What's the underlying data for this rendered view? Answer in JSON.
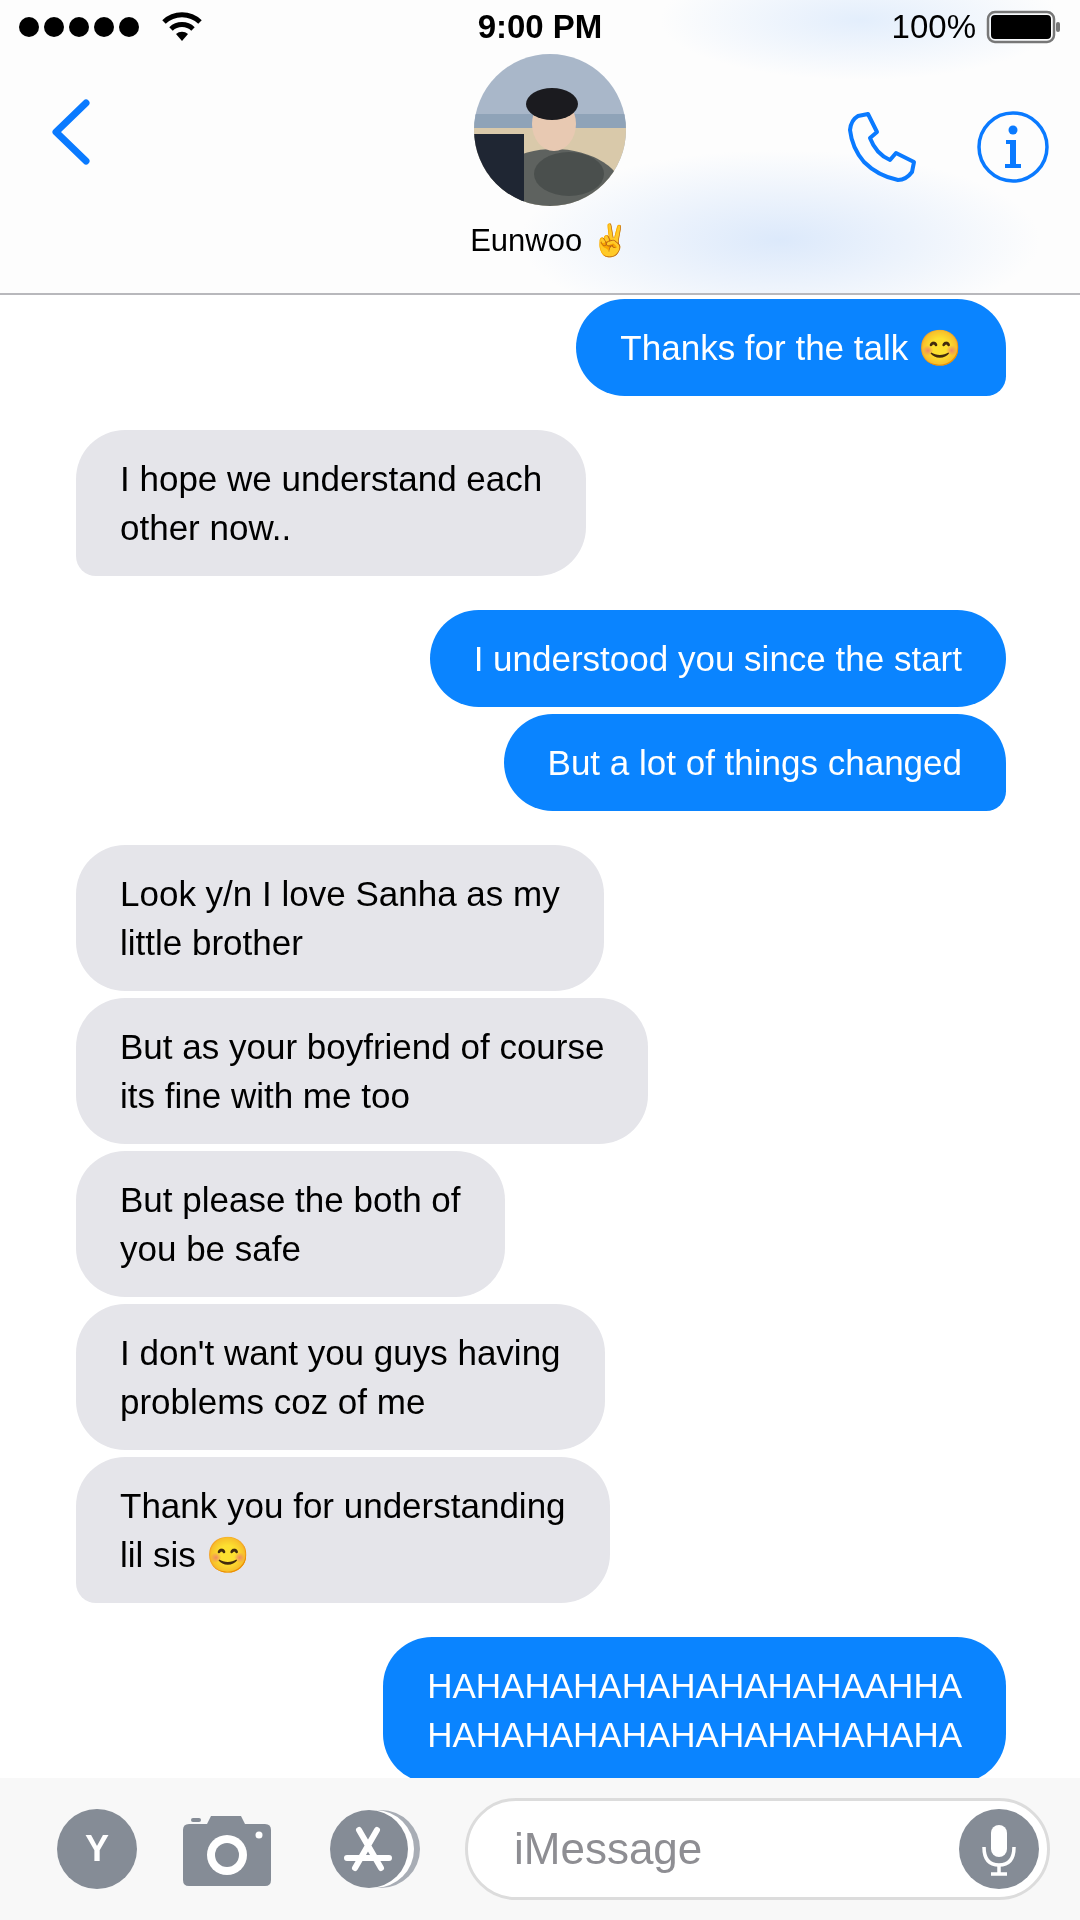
{
  "status_bar": {
    "time": "9:00 PM",
    "battery": "100%"
  },
  "header": {
    "contact_name": "Eunwoo ✌️"
  },
  "messages": [
    {
      "outgoing": true,
      "tail": true,
      "text": "Thanks for the talk 😊"
    },
    {
      "outgoing": false,
      "tail": true,
      "text": "I hope we understand each\nother now.."
    },
    {
      "outgoing": true,
      "tail": false,
      "text": "I understood you since the start"
    },
    {
      "outgoing": true,
      "tail": true,
      "text": "But a lot of things changed"
    },
    {
      "outgoing": false,
      "tail": false,
      "text": "Look y/n I love Sanha as my\nlittle brother"
    },
    {
      "outgoing": false,
      "tail": false,
      "text": "But as your boyfriend of course\nits fine with me too"
    },
    {
      "outgoing": false,
      "tail": false,
      "text": "But please the both of\nyou be safe"
    },
    {
      "outgoing": false,
      "tail": false,
      "text": "I don't want you guys having\nproblems coz of me"
    },
    {
      "outgoing": false,
      "tail": true,
      "text": "Thank you for understanding\nlil sis 😊"
    },
    {
      "outgoing": true,
      "tail": false,
      "text": "HAHAHAHAHAHAHAHAHAAHHA\nHAHAHAHAHAHAHAHAHAHAHA"
    }
  ],
  "compose": {
    "account_initial": "Y",
    "placeholder": "iMessage"
  }
}
